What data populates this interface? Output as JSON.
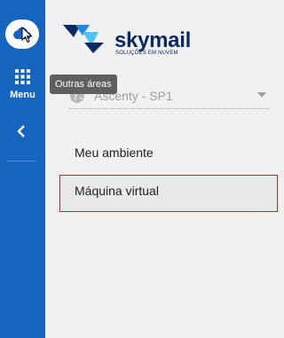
{
  "sidebar": {
    "cloud_icon": "cloud-icon",
    "menu_label": "Menu",
    "menu_icon": "apps-grid-icon",
    "collapse_icon": "chevron-left-icon"
  },
  "tooltip": {
    "text": "Outras áreas"
  },
  "logo": {
    "brand": "skymail",
    "tagline": "SOLUÇÕES EM NUVEM"
  },
  "environment_select": {
    "value": "Ascenty - SP1",
    "icon": "globe-icon"
  },
  "nav": {
    "items": [
      {
        "label": "Meu ambiente"
      },
      {
        "label": "Máquina virtual",
        "highlighted": true
      }
    ]
  },
  "colors": {
    "rail": "#1565c0",
    "brand": "#0b2a62",
    "highlight_border": "#c8242b"
  }
}
